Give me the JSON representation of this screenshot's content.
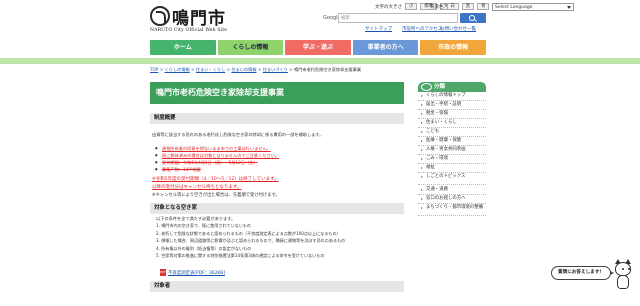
{
  "header": {
    "logo_text": "鳴門市",
    "logo_sub": "NARUTO City Official Web Site",
    "util_text_size_label": "文字の大きさ",
    "util_text_size_options": [
      "小",
      "標準",
      "大"
    ],
    "util_bg_label": "背景色",
    "util_bg_options": [
      "白",
      "黒",
      "青"
    ],
    "lang_select": "Select Language",
    "google_label": "Google",
    "search_placeholder": "検索",
    "links": [
      "サイトマップ",
      "市役所へのアクセス"
    ],
    "link_mobile": "お問い合わせ一覧"
  },
  "nav": {
    "items": [
      "ホーム",
      "くらしの情報",
      "学ぶ・遊ぶ",
      "事業者の方へ",
      "市政の情報"
    ]
  },
  "breadcrumb": [
    "TOP",
    "くらしの情報",
    "住まい・くらし",
    "住まいの情報",
    "住まいづくり",
    "鳴門市老朽危険空き家除却支援事業"
  ],
  "main": {
    "title": "鳴門市老朽危険空き家除却支援事業",
    "section1_heading": "制度概要",
    "section1_text": "出資等に該当する恐れのある老朽化し危険な空き家の除却に係る費用の一部を補助します。",
    "bullets": [
      "建物所有者の同意を得ないまま市での工事は行いません。",
      "既に解体済みの場合は対象となりませんのでご注意ください。",
      "受付期間：令和5年4月1日（月）～5月12日（金）",
      "募集戸数：10戸程度"
    ],
    "red_note_1": "※令和5年度の受付期間（4／10～5／12）は終了しています。",
    "red_note_2": "以降の受付分はキャンセル待ちとなります。",
    "note": "※キャンセル等により空きが出た場合は、先着順で受け付けます。",
    "section2_heading": "対象となる空き家",
    "section2_intro": "以下の条件を全て満たす必要があります。",
    "list": [
      "1. 鳴門市内の空き家で、既に使用されていないもの",
      "2. 老朽して危険な状態であると認められるもの（不良度測定表による点数が100点以上になるもの）",
      "3. 倒壊した場合、周辺道路等に影響が及ぶと認められるもので、隣接に建物等を及ぼす恐れのあるもの",
      "4. 所有権以外の権利（抵当権等）の設定がないもの",
      "5. 空家等対策の推進に関する特別措置法第14条第3項の規定による命令を受けていないもの"
    ],
    "pdf_label": "不良度測定表[PDF：362KB]",
    "section3_heading": "対象者"
  },
  "sidebar": {
    "heading": "分類",
    "items": [
      "くらしの情報トップ",
      "届出・手続・証明",
      "税金・保険",
      "住まい・くらし",
      "こども",
      "医療・健康・保健",
      "人権・男女共同参画",
      "ごみ・環境",
      "福祉",
      "しごとのトピックス",
      "交通・道路",
      "窓口のお越しの方へ",
      "まちづくり・都市環境の整備"
    ]
  },
  "chat": {
    "label": "質問にお答えします！"
  },
  "colors": {
    "accent_green": "#3b9f5a",
    "nav_home": "#45b46d",
    "nav_life": "#8ed36b",
    "nav_learn": "#f06c64",
    "nav_biz": "#6a98d8",
    "nav_city": "#f1a63b",
    "alert_red": "#e0262a"
  }
}
